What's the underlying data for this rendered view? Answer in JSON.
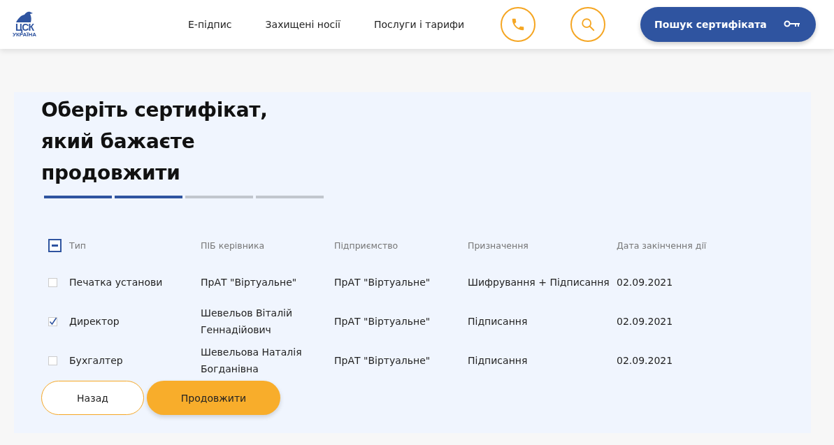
{
  "logo": {
    "title": "ЦСК",
    "subtitle": "УКРАЇНА"
  },
  "nav": [
    "Е-підпис",
    "Захищені носії",
    "Послуги і тарифи"
  ],
  "cert_search_button": "Пошук сертифіката",
  "title": "Оберіть сертифікат, який бажаєте продовжити",
  "steps": [
    {
      "done": true
    },
    {
      "done": true
    },
    {
      "done": false
    },
    {
      "done": false
    }
  ],
  "table": {
    "select_all_indeterminate": true,
    "columns": [
      "Тип",
      "ПІБ керівника",
      "Підприємство",
      "Призначення",
      "Дата закінчення дії"
    ],
    "rows": [
      {
        "checked": false,
        "cells": [
          "Печатка установи",
          "ПрАТ \"Віртуальне\"",
          "ПрАТ \"Віртуальне\"",
          "Шифрування + Підписання",
          "02.09.2021"
        ]
      },
      {
        "checked": true,
        "cells": [
          "Директор",
          "Шевельов Віталій Геннадійович",
          "ПрАТ \"Віртуальне\"",
          "Підписання",
          "02.09.2021"
        ]
      },
      {
        "checked": false,
        "cells": [
          "Бухгалтер",
          "Шевельова Наталія Богданівна",
          "ПрАТ \"Віртуальне\"",
          "Підписання",
          "02.09.2021"
        ]
      }
    ]
  },
  "buttons": {
    "back": "Назад",
    "continue": "Продовжити"
  }
}
